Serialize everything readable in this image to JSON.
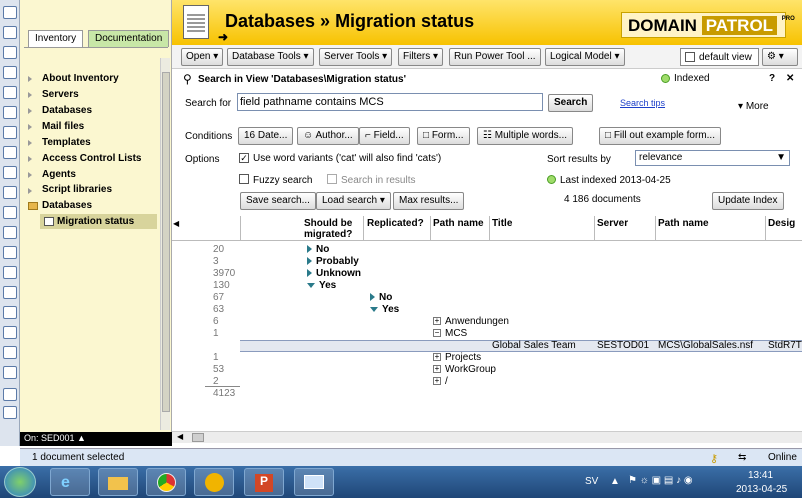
{
  "nav": {
    "tabs": [
      "Inventory",
      "Documentation"
    ],
    "items": [
      "About Inventory",
      "Servers",
      "Databases",
      "Mail files",
      "Templates",
      "Access Control Lists",
      "Agents",
      "Script libraries",
      "Databases",
      "Migration status"
    ],
    "status": "On: SED001 ▲"
  },
  "header": {
    "title": "Databases » Migration status",
    "logo_left": "DOMAIN",
    "logo_right": "PATROL",
    "logo_small": "PRO"
  },
  "toolbar": {
    "open": "Open ▾",
    "database_tools": "Database Tools ▾",
    "server_tools": "Server Tools ▾",
    "filters": "Filters ▾",
    "run_power_tool": "Run Power Tool ...",
    "logical_model": "Logical Model ▾",
    "default_view": "default view"
  },
  "search": {
    "heading": "Search in View 'Databases\\Migration status'",
    "indexed": "Indexed",
    "help": "?",
    "close": "✕",
    "search_for_label": "Search for",
    "query": "field pathname contains MCS",
    "search_button": "Search",
    "tips": "Search tips",
    "more": "More",
    "conditions_label": "Conditions",
    "date": "Date...",
    "author": "Author...",
    "field": "Field...",
    "form": "Form...",
    "multiple_words": "Multiple words...",
    "fill_example": "Fill out example form...",
    "options_label": "Options",
    "word_variants": "Use word variants ('cat' will also find 'cats')",
    "fuzzy": "Fuzzy search",
    "in_results": "Search in results",
    "sort_label": "Sort results by",
    "sort_value": "relevance",
    "last_indexed": "Last indexed",
    "last_indexed_date": "2013-04-25",
    "doc_count": "4 186",
    "documents_label": "documents",
    "save_search": "Save search...",
    "load_search": "Load search",
    "max_results": "Max results...",
    "update_index": "Update Index"
  },
  "grid": {
    "columns": [
      "Should be migrated?",
      "Replicated?",
      "Path name",
      "Title",
      "Server",
      "Path name",
      "Desig"
    ],
    "rows": [
      {
        "count": "20",
        "label": "No"
      },
      {
        "count": "3",
        "label": "Probably"
      },
      {
        "count": "3970",
        "label": "Unknown"
      },
      {
        "count": "130",
        "label": "Yes"
      },
      {
        "count": "67",
        "label": "No"
      },
      {
        "count": "63",
        "label": "Yes"
      },
      {
        "count": "6",
        "label": "Anwendungen"
      },
      {
        "count": "1",
        "label": "MCS"
      },
      {
        "count": "1",
        "label": "Projects"
      },
      {
        "count": "53",
        "label": "WorkGroup"
      },
      {
        "count": "2",
        "label": "/"
      }
    ],
    "detail": {
      "title": "Global Sales Team",
      "server": "SESTOD01",
      "path": "MCS\\GlobalSales.nsf",
      "design": "StdR7T"
    },
    "total": "4123"
  },
  "status": {
    "selected": "1 document selected",
    "online": "Online"
  },
  "taskbar": {
    "lang": "SV",
    "time": "13:41",
    "date": "2013-04-25"
  }
}
